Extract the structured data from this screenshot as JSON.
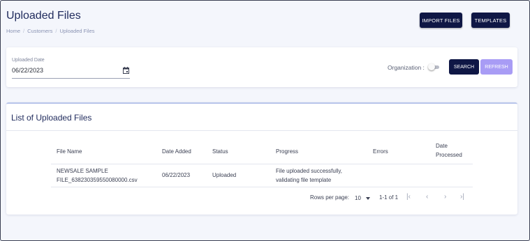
{
  "header": {
    "title": "Uploaded Files",
    "breadcrumb": [
      "Home",
      "Customers",
      "Uploaded Files"
    ],
    "breadcrumb_separator": "/",
    "import_label": "IMPORT FILES",
    "templates_label": "TEMPLATES"
  },
  "filters": {
    "date_label": "Uploaded Date",
    "date_value": "06/22/2023",
    "organization_label": "Organization :",
    "organization_on": false,
    "search_label": "SEARCH",
    "refresh_label": "REFRESH"
  },
  "list": {
    "title": "List of Uploaded Files",
    "columns": {
      "file_name": "File Name",
      "date_added": "Date Added",
      "status": "Status",
      "progress": "Progress",
      "errors": "Errors",
      "date_processed_1": "Date",
      "date_processed_2": "Processed"
    },
    "rows": [
      {
        "file_name_1": "NEWSALE SAMPLE",
        "file_name_2": "FILE_638230359550080000.csv",
        "date_added": "06/22/2023",
        "status": "Uploaded",
        "progress_1": "File uploaded successfully,",
        "progress_2": "validating file template",
        "errors": "",
        "date_processed": ""
      }
    ],
    "pagination": {
      "rows_per_page_label": "Rows per page:",
      "rows_per_page_value": "10",
      "range": "1-1 of 1"
    }
  },
  "colors": {
    "primary": "#0f1745",
    "refresh": "#a89cf5",
    "title": "#1f2a5c",
    "background": "#f4f6fc"
  }
}
